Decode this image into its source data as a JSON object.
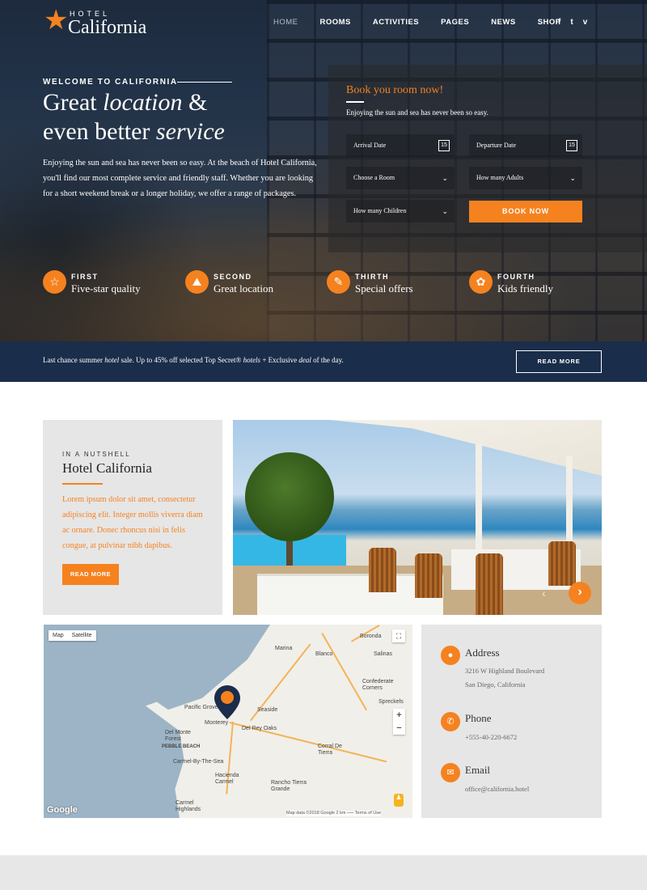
{
  "brand": {
    "small": "HOTEL",
    "name": "California",
    "accent": "#f5821f",
    "navy": "#1a2d4a"
  },
  "nav": {
    "items": [
      {
        "label": "HOME",
        "active": true
      },
      {
        "label": "ROOMS",
        "active": false
      },
      {
        "label": "ACTIVITIES",
        "active": false
      },
      {
        "label": "PAGES",
        "active": false
      },
      {
        "label": "NEWS",
        "active": false
      },
      {
        "label": "SHOP",
        "active": false
      }
    ],
    "social": [
      "f",
      "t",
      "v"
    ]
  },
  "hero": {
    "welcome": "WELCOME TO CALIFORNIA",
    "line1_a": "Great ",
    "line1_b": "location",
    "line1_c": " &",
    "line2_a": "even better ",
    "line2_b": "service",
    "text": "Enjoying the sun and sea has never been so easy. At the beach of Hotel California, you'll find our most complete service and friendly staff. Whether you are looking for a short weekend break or a longer holiday, we offer a range of packages."
  },
  "booking": {
    "title": "Book you room now!",
    "subtitle": "Enjoying the sun and sea has never been so easy.",
    "arrival": "Arrival Date",
    "departure": "Departure Date",
    "calendar_day": "15",
    "room": "Choose a Room",
    "adults": "How many Adults",
    "children": "How many Children",
    "button": "BOOK NOW"
  },
  "features": [
    {
      "key": "FIRST",
      "value": "Five-star quality",
      "icon": "star-icon"
    },
    {
      "key": "SECOND",
      "value": "Great location",
      "icon": "map-icon"
    },
    {
      "key": "THIRTH",
      "value": "Special offers",
      "icon": "tag-icon"
    },
    {
      "key": "FOURTH",
      "value": "Kids friendly",
      "icon": "flower-icon"
    }
  ],
  "promo": {
    "t1": "Last chance summer ",
    "t2": "hotel",
    "t3": " sale. Up to 45% off selected Top Secret® ",
    "t4": "hotels",
    "t5": " + Exclusive ",
    "t6": "deal",
    "t7": " of the day.",
    "button": "READ MORE"
  },
  "nutshell": {
    "kicker": "IN A NUTSHELL",
    "title": "Hotel California",
    "text": "Lorem ipsum dolor sit amet, consectetur adipiscing elit. Integer mollis viverra diam ac ornare. Donec rhoncus nisi in felis congue, at pulvinar nibh dapibus.",
    "button": "READ MORE"
  },
  "map": {
    "map_btn": "Map",
    "satellite_btn": "Satellite",
    "labels": [
      "Marina",
      "Boronda",
      "Blanco",
      "Salinas",
      "Confederate Corners",
      "Spreckels",
      "Seaside",
      "Pacific Grove",
      "Monterey",
      "Del Rey Oaks",
      "Del Monte Forest",
      "PEBBLE BEACH",
      "Carmel-By-The-Sea",
      "Corral De Tierra",
      "Hacienda Carmel",
      "Rancho Tierra Grande",
      "Carmel Highlands"
    ],
    "google": "Google",
    "footer": "Map data ©2018 Google   2 km ⎯⎯⎯   Terms of Use",
    "zoom_in": "+",
    "zoom_out": "−"
  },
  "contact": {
    "address_title": "Address",
    "address_line1": "3216 W Highland Boulevard",
    "address_line2": "San Diego, California",
    "phone_title": "Phone",
    "phone": "+555-40-220-6672",
    "email_title": "Email",
    "email": "office@california.hotel"
  }
}
